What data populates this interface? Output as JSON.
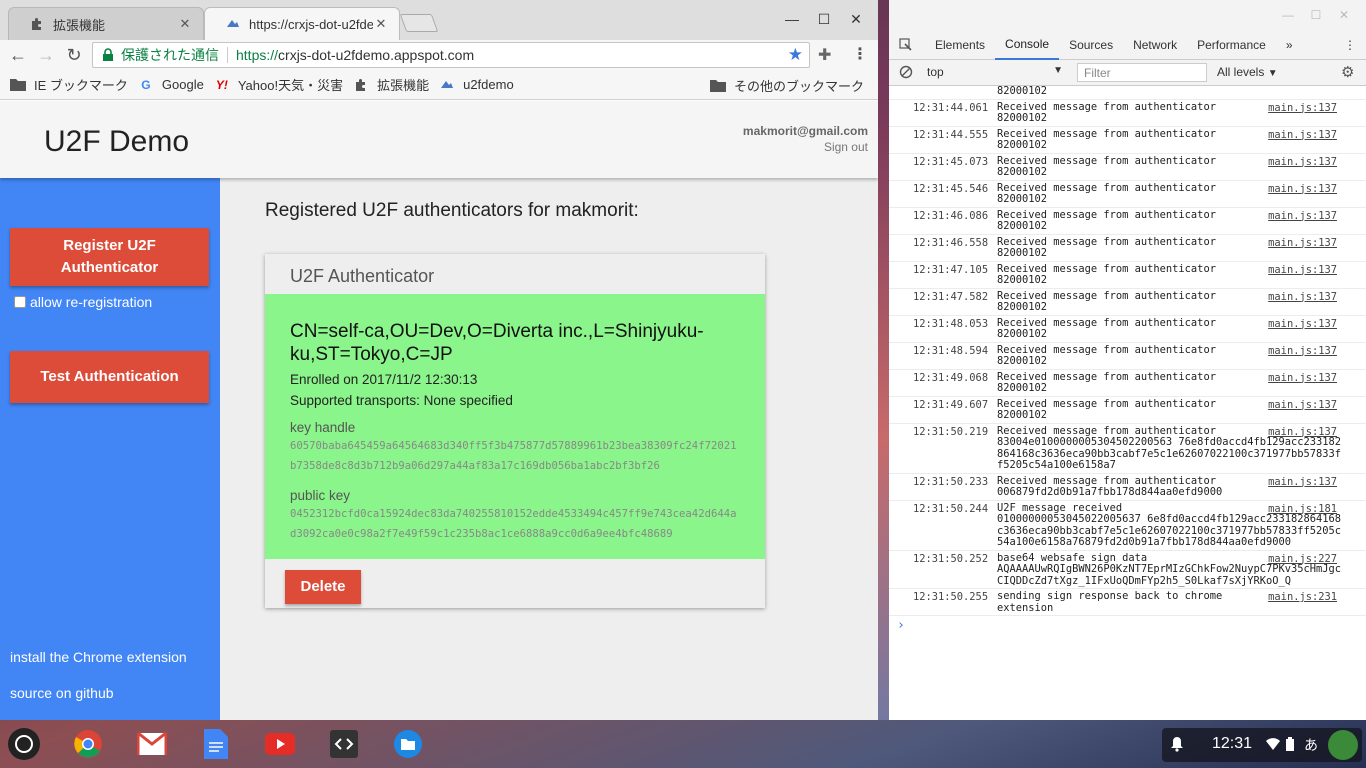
{
  "browser": {
    "tabs": [
      {
        "title": "拡張機能",
        "active": false
      },
      {
        "title": "https://crxjs-dot-u2fdem",
        "active": true
      }
    ],
    "omnibox": {
      "secure_text": "保護された通信",
      "url_scheme": "https://",
      "url_host": "crxjs-dot-u2fdemo.appspot.com"
    },
    "bookmarks": [
      "IE ブックマーク",
      "Google",
      "Yahoo!天気・災害",
      "拡張機能",
      "u2fdemo"
    ],
    "other_bookmarks": "その他のブックマーク"
  },
  "page": {
    "title": "U2F Demo",
    "user_email": "makmorit@gmail.com",
    "sign_out": "Sign out",
    "sidebar": {
      "register_line1": "Register U2F",
      "register_line2": "Authenticator",
      "allow_rereg": "allow re-registration",
      "test_auth": "Test Authentication",
      "install_link": "install the Chrome extension",
      "source_link": "source on github"
    },
    "heading": "Registered U2F authenticators for makmorit:",
    "card": {
      "header": "U2F Authenticator",
      "cn": "CN=self-ca,OU=Dev,O=Diverta inc.,L=Shinjyuku-ku,ST=Tokyo,C=JP",
      "enrolled": "Enrolled on 2017/11/2 12:30:13",
      "transports": "Supported transports: None specified",
      "key_handle_label": "key handle",
      "key_handle": "60570baba645459a64564683d340ff5f3b475877d57889961b23bea38309fc24f72021b7358de8c8d3b712b9a06d297a44af83a17c169db056ba1abc2bf3bf26",
      "public_key_label": "public key",
      "public_key": "0452312bcfd0ca15924dec83da740255810152edde4533494c457ff9e743cea42d644ad3092ca0e0c98a2f7e49f59c1c235b8ac1ce6888a9cc0d6a9ee4bfc48689",
      "delete": "Delete"
    }
  },
  "devtools": {
    "tabs": [
      "Elements",
      "Console",
      "Sources",
      "Network",
      "Performance",
      "»"
    ],
    "active_tab": "Console",
    "context": "top",
    "filter_placeholder": "Filter",
    "levels": "All levels",
    "top_fragment": "82000102",
    "rows": [
      {
        "ts": "12:31:44.061",
        "msg": "Received message from authenticator\n82000102",
        "src": "main.js:137"
      },
      {
        "ts": "12:31:44.555",
        "msg": "Received message from authenticator\n82000102",
        "src": "main.js:137"
      },
      {
        "ts": "12:31:45.073",
        "msg": "Received message from authenticator\n82000102",
        "src": "main.js:137"
      },
      {
        "ts": "12:31:45.546",
        "msg": "Received message from authenticator\n82000102",
        "src": "main.js:137"
      },
      {
        "ts": "12:31:46.086",
        "msg": "Received message from authenticator\n82000102",
        "src": "main.js:137"
      },
      {
        "ts": "12:31:46.558",
        "msg": "Received message from authenticator\n82000102",
        "src": "main.js:137"
      },
      {
        "ts": "12:31:47.105",
        "msg": "Received message from authenticator\n82000102",
        "src": "main.js:137"
      },
      {
        "ts": "12:31:47.582",
        "msg": "Received message from authenticator\n82000102",
        "src": "main.js:137"
      },
      {
        "ts": "12:31:48.053",
        "msg": "Received message from authenticator\n82000102",
        "src": "main.js:137"
      },
      {
        "ts": "12:31:48.594",
        "msg": "Received message from authenticator\n82000102",
        "src": "main.js:137"
      },
      {
        "ts": "12:31:49.068",
        "msg": "Received message from authenticator\n82000102",
        "src": "main.js:137"
      },
      {
        "ts": "12:31:49.607",
        "msg": "Received message from authenticator\n82000102",
        "src": "main.js:137"
      },
      {
        "ts": "12:31:50.219",
        "msg": "Received message from authenticator\n83004e0100000005304502200563 76e8fd0accd4fb129acc233182864168c3636eca90bb3cabf7e5c1e62607022100c371977bb57833ff5205c54a100e6158a7",
        "src": "main.js:137",
        "wide": true
      },
      {
        "ts": "12:31:50.233",
        "msg": "Received message from authenticator\n006879fd2d0b91a7fbb178d844aa0efd9000",
        "src": "main.js:137"
      },
      {
        "ts": "12:31:50.244",
        "msg": "U2F message received\n01000000053045022005637 6e8fd0accd4fb129acc233182864168c3636eca90bb3cabf7e5c1e62607022100c371977bb57833ff5205c54a100e6158a76879fd2d0b91a7fbb178d844aa0efd9000",
        "src": "main.js:181",
        "wide": true
      },
      {
        "ts": "12:31:50.252",
        "msg": "base64 websafe sign data\nAQAAAAUwRQIgBWN26P0KzNT7EprMIzGChkFow2NuypC7PKv35cHmJgcCIQDDcZd7tXgz_1IFxUoQDmFYp2h5_S0Lkaf7sXjYRKoO_Q",
        "src": "main.js:227",
        "wide": true
      },
      {
        "ts": "12:31:50.255",
        "msg": "sending sign response back to chrome\nextension",
        "src": "main.js:231"
      }
    ]
  },
  "shelf": {
    "time": "12:31",
    "ime": "あ",
    "apps": [
      "launcher",
      "chrome",
      "gmail",
      "docs",
      "youtube",
      "text-editor",
      "files"
    ]
  }
}
